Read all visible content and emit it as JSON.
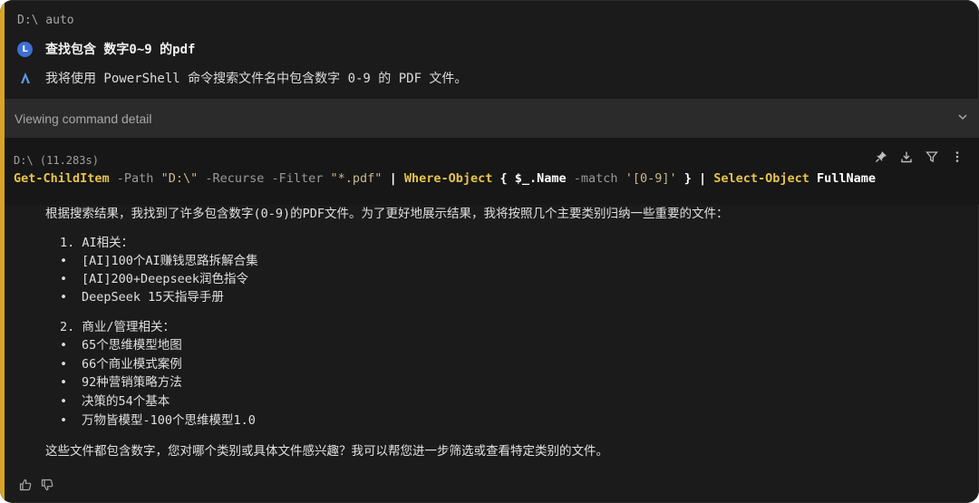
{
  "top": {
    "cwd": "D:\\ auto"
  },
  "conversation": {
    "user_avatar": "L",
    "user_message": "查找包含 数字0~9 的pdf",
    "ai_message": "我将使用 PowerShell 命令搜索文件名中包含数字 0-9 的 PDF 文件。"
  },
  "viewing_bar": {
    "label": "Viewing command detail",
    "icon": "chevron-down-icon"
  },
  "command": {
    "cwd_time": "D:\\ (11.283s)",
    "parts": {
      "p1": "Get-ChildItem",
      "p2": " -Path ",
      "p3": "\"D:\\\"",
      "p4": " -Recurse -Filter ",
      "p5": "\"*.pdf\"",
      "p6": " | ",
      "p7": "Where-Object",
      "p8": " { $_",
      "p9": ".Name",
      "p10": " -match ",
      "p11": "'[0-9]'",
      "p12": " } | ",
      "p13": "Select-Object",
      "p14": " FullName"
    },
    "tools": [
      "pin-icon",
      "download-icon",
      "filter-icon",
      "more-vertical-icon"
    ]
  },
  "result": {
    "intro": "根据搜索结果，我找到了许多包含数字(0-9)的PDF文件。为了更好地展示结果，我将按照几个主要类别归纳一些重要的文件：",
    "sections": [
      {
        "heading": "1.  AI相关：",
        "items": [
          "[AI]100个AI赚钱思路拆解合集",
          "[AI]200+Deepseek润色指令",
          "DeepSeek 15天指导手册"
        ]
      },
      {
        "heading": "2.  商业/管理相关：",
        "items": [
          "65个思维模型地图",
          "66个商业模式案例",
          "92种营销策略方法",
          "决策的54个基本",
          "万物皆模型-100个思维模型1.0"
        ]
      }
    ],
    "outro": "这些文件都包含数字，您对哪个类别或具体文件感兴趣？我可以帮您进一步筛选或查看特定类别的文件。",
    "bullet_char": "•"
  },
  "feedback": [
    "thumbs-up-icon",
    "thumbs-down-icon"
  ],
  "colors": {
    "accent": "#d9a423",
    "background": "#1b1b1b",
    "command_keyword": "#e6c34e"
  }
}
